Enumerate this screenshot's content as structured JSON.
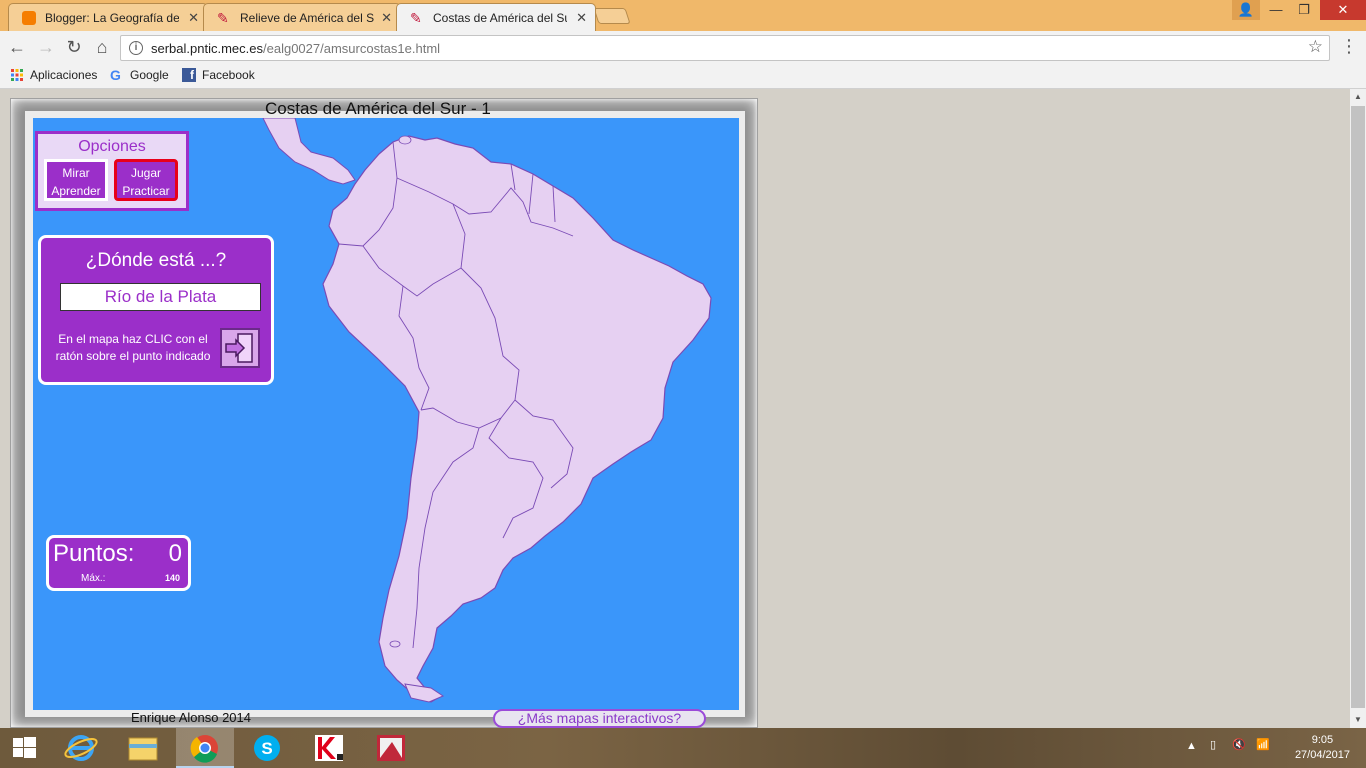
{
  "browser": {
    "tabs": [
      {
        "label": "Blogger: La Geografía de",
        "favicon_color": "#f57d00",
        "active": false
      },
      {
        "label": "Relieve de América del Su",
        "favicon_color": "#c0183c",
        "active": false
      },
      {
        "label": "Costas de América del Su",
        "favicon_color": "#c0183c",
        "active": true
      }
    ],
    "url_host": "serbal.pntic.mec.es",
    "url_path": "/ealg0027/amsurcostas1e.html",
    "bookmarks": [
      {
        "label": "Aplicaciones",
        "icon": "apps-grid-icon"
      },
      {
        "label": "Google",
        "icon": "google-g-icon"
      },
      {
        "label": "Facebook",
        "icon": "facebook-icon"
      }
    ]
  },
  "game": {
    "title": "Costas de América del Sur - 1",
    "options_title": "Opciones",
    "mirar_label_1": "Mirar",
    "mirar_label_2": "Aprender",
    "jugar_label_1": "Jugar",
    "jugar_label_2": "Practicar",
    "question_title": "¿Dónde está ...?",
    "question_answer": "Río de la Plata",
    "question_help": "En el mapa haz CLIC con el ratón sobre el punto indicado",
    "score_label": "Puntos:",
    "score_value": "0",
    "score_max_label": "Máx.:",
    "score_max_value": "140",
    "credit": "Enrique Alonso 2014",
    "more_maps": "¿Más mapas interactivos?",
    "colors": {
      "sea": "#3a96fa",
      "land": "#e6d0f2",
      "panel": "#9b2fc9",
      "border": "#7a4bb5"
    }
  },
  "taskbar": {
    "time": "9:05",
    "date": "27/04/2017",
    "apps": [
      "internet-explorer-icon",
      "file-explorer-icon",
      "chrome-icon",
      "skype-icon",
      "kaspersky-icon",
      "image-app-icon"
    ]
  }
}
